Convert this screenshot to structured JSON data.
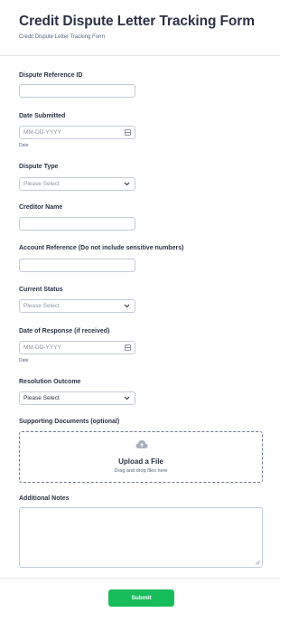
{
  "form": {
    "title": "Credit Dispute Letter Tracking Form",
    "subtitle": "Credit Dispute Letter Tracking Form"
  },
  "fields": {
    "dispute_reference_id": {
      "label": "Dispute Reference ID",
      "value": ""
    },
    "date_submitted": {
      "label": "Date Submitted",
      "placeholder": "MM-DD-YYYY",
      "sublabel": "Date",
      "icon": "calendar-icon"
    },
    "dispute_type": {
      "label": "Dispute Type",
      "selected": "Please Select",
      "icon": "chevron-down-icon"
    },
    "creditor_name": {
      "label": "Creditor Name",
      "value": ""
    },
    "account_reference": {
      "label": "Account Reference (Do not include sensitive numbers)",
      "value": ""
    },
    "current_status": {
      "label": "Current Status",
      "selected": "Please Select",
      "icon": "chevron-down-icon"
    },
    "date_of_response": {
      "label": "Date of Response (if received)",
      "placeholder": "MM-DD-YYYY",
      "sublabel": "Date",
      "icon": "calendar-icon"
    },
    "resolution_outcome": {
      "label": "Resolution Outcome",
      "selected": "Please Select",
      "icon": "chevron-down-icon"
    },
    "supporting_documents": {
      "label": "Supporting Documents (optional)",
      "upload_title": "Upload a File",
      "upload_hint": "Drag and drop files here",
      "icon": "cloud-upload-icon"
    },
    "additional_notes": {
      "label": "Additional Notes",
      "value": ""
    }
  },
  "actions": {
    "submit_label": "Submit",
    "submit_color": "#18bd5b"
  }
}
